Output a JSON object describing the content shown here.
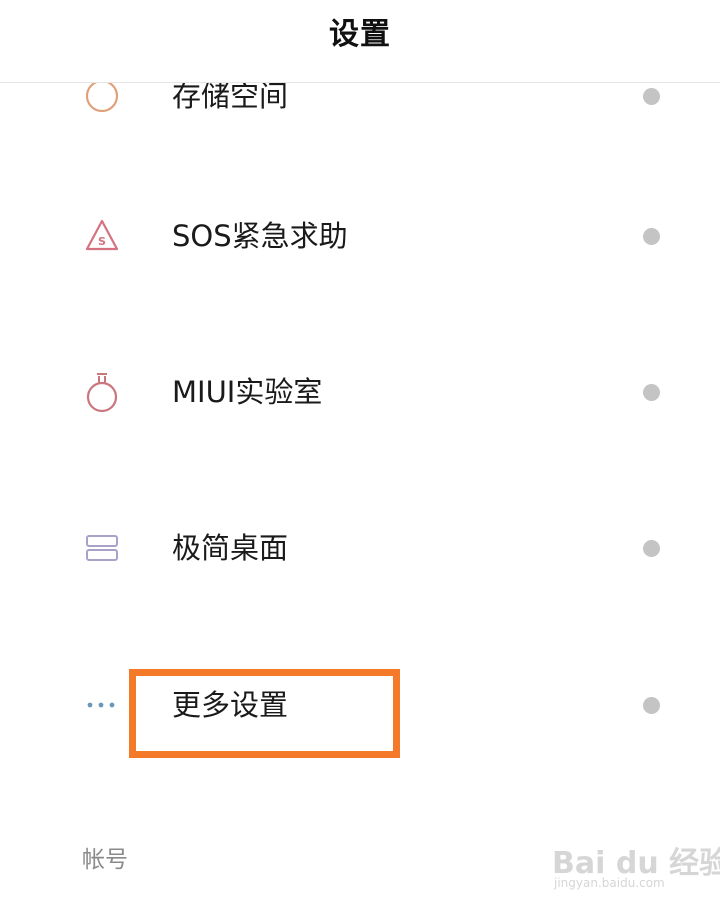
{
  "header": {
    "title": "设置"
  },
  "items": [
    {
      "label": "存储空间",
      "icon": "storage-icon"
    },
    {
      "label": "SOS紧急求助",
      "icon": "sos-icon"
    },
    {
      "label": "MIUI实验室",
      "icon": "lab-flask-icon"
    },
    {
      "label": "极简桌面",
      "icon": "simple-desktop-icon"
    },
    {
      "label": "更多设置",
      "icon": "more-dots-icon"
    }
  ],
  "section": {
    "account_label": "帐号"
  },
  "watermark": {
    "main": "Bai du 经验",
    "sub": "jingyan.baidu.com"
  },
  "colors": {
    "highlight": "#f47a2a",
    "dot": "#c4c4c4",
    "sos_icon": "#d4727f",
    "lab_icon": "#c9767f",
    "desktop_icon": "#a9a1c8",
    "more_icon": "#6a98b8",
    "storage_icon": "#e0a07a"
  }
}
